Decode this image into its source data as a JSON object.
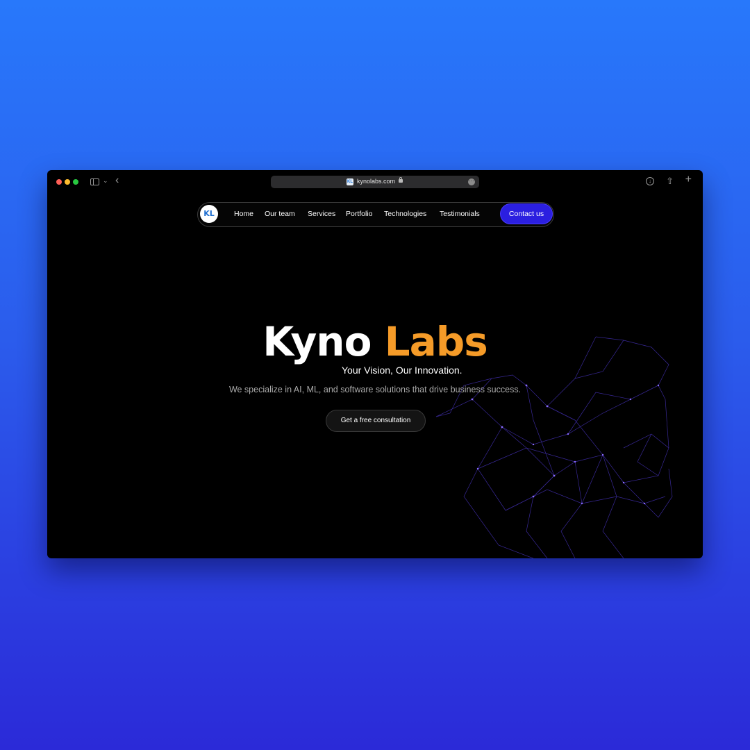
{
  "browser": {
    "url": "kynolabs.com",
    "favicon_text": "KL"
  },
  "nav": {
    "logo_text": "KL",
    "links": [
      "Home",
      "Our team",
      "Services",
      "Portfolio",
      "Technologies",
      "Testimonials"
    ],
    "cta_label": "Contact us"
  },
  "hero": {
    "title_primary": "Kyno",
    "title_accent": "Labs",
    "tagline": "Your Vision, Our Innovation.",
    "description": "We specialize in AI, ML, and software solutions that drive business success.",
    "cta_label": "Get a free consultation"
  },
  "colors": {
    "accent_orange": "#f59b28",
    "primary_blue": "#2b1fe0",
    "network_purple": "#5b3fd8"
  },
  "icons": [
    "sidebar-icon",
    "chevron-down-icon",
    "back-icon",
    "lock-icon",
    "more-icon",
    "download-icon",
    "share-icon",
    "new-tab-icon"
  ]
}
